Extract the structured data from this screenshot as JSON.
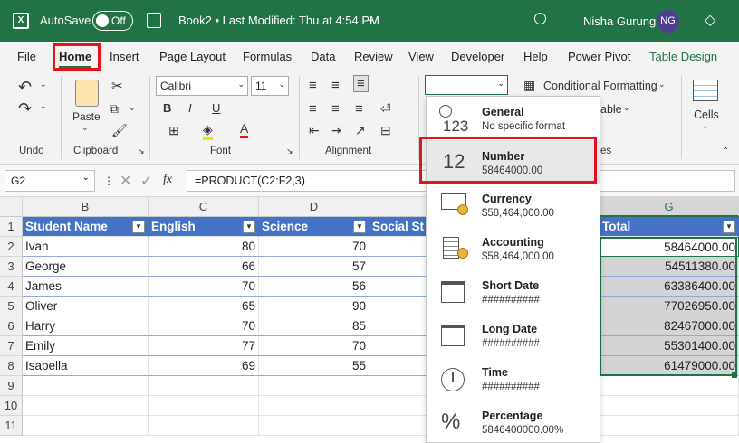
{
  "titlebar": {
    "autosave": "AutoSave",
    "toggle": "Off",
    "title": "Book2 • Last Modified: Thu at 4:54 PM",
    "user": "Nisha Gurung",
    "initials": "NG"
  },
  "tabs": [
    "File",
    "Home",
    "Insert",
    "Page Layout",
    "Formulas",
    "Data",
    "Review",
    "View",
    "Developer",
    "Help",
    "Power Pivot",
    "Table Design"
  ],
  "ribbon": {
    "groups": {
      "undo": "Undo",
      "clipboard": "Clipboard",
      "font": "Font",
      "alignment": "Alignment",
      "styles": "es",
      "cells": "Cells"
    },
    "paste": "Paste",
    "font_name": "Calibri",
    "font_size": "11",
    "number_format": "",
    "conditional_formatting": "Conditional Formatting",
    "format_table_partial": "able",
    "cells_label": "Cells"
  },
  "formula_bar": {
    "name_box": "G2",
    "fx": "fx",
    "formula": "=PRODUCT(C2:F2,3)"
  },
  "sheet": {
    "columns": [
      "B",
      "C",
      "D",
      "",
      "G"
    ],
    "rows": [
      "1",
      "2",
      "3",
      "4",
      "5",
      "6",
      "7",
      "8",
      "9",
      "10",
      "11"
    ],
    "headers": [
      "Student Name",
      "English",
      "Science",
      "Social St",
      "Total"
    ],
    "data": [
      [
        "Ivan",
        "80",
        "70",
        "58464000.00"
      ],
      [
        "George",
        "66",
        "57",
        "54511380.00"
      ],
      [
        "James",
        "70",
        "56",
        "63386400.00"
      ],
      [
        "Oliver",
        "65",
        "90",
        "77026950.00"
      ],
      [
        "Harry",
        "70",
        "85",
        "82467000.00"
      ],
      [
        "Emily",
        "77",
        "70",
        "55301400.00"
      ],
      [
        "Isabella",
        "69",
        "55",
        "61479000.00"
      ]
    ]
  },
  "number_format_menu": [
    {
      "icon": "123",
      "title": "General",
      "sample": "No specific format"
    },
    {
      "icon": "12",
      "title": "Number",
      "sample": "58464000.00"
    },
    {
      "icon": "currency-icon",
      "title": "Currency",
      "sample": "$58,464,000.00"
    },
    {
      "icon": "accounting-icon",
      "title": "Accounting",
      "sample": " $58,464,000.00"
    },
    {
      "icon": "calendar-icon",
      "title": "Short Date",
      "sample": "##########"
    },
    {
      "icon": "calendar-icon",
      "title": "Long Date",
      "sample": "##########"
    },
    {
      "icon": "clock-icon",
      "title": "Time",
      "sample": "##########"
    },
    {
      "icon": "%",
      "title": "Percentage",
      "sample": "5846400000.00%"
    }
  ],
  "colors": {
    "excel_green": "#217346",
    "table_header": "#4472c4",
    "highlight": "#e3141b"
  }
}
